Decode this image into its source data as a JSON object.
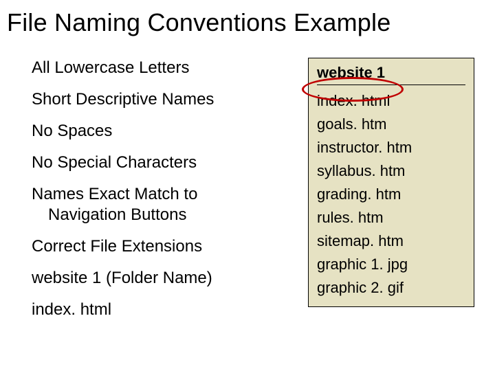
{
  "title": "File Naming Conventions Example",
  "rules": [
    "All Lowercase Letters",
    "Short Descriptive Names",
    "No Spaces",
    "No Special Characters",
    "Names Exact Match to Navigation Buttons",
    "Correct File Extensions",
    "website 1 (Folder Name)",
    "index. html"
  ],
  "rules_split": {
    "4a": "Names Exact Match to",
    "4b": "Navigation Buttons"
  },
  "filebox": {
    "header": "website 1",
    "files": [
      "index. html",
      "goals. htm",
      "instructor. htm",
      "syllabus. htm",
      "grading. htm",
      "rules. htm",
      "sitemap. htm",
      "graphic 1. jpg",
      "graphic 2. gif"
    ]
  }
}
